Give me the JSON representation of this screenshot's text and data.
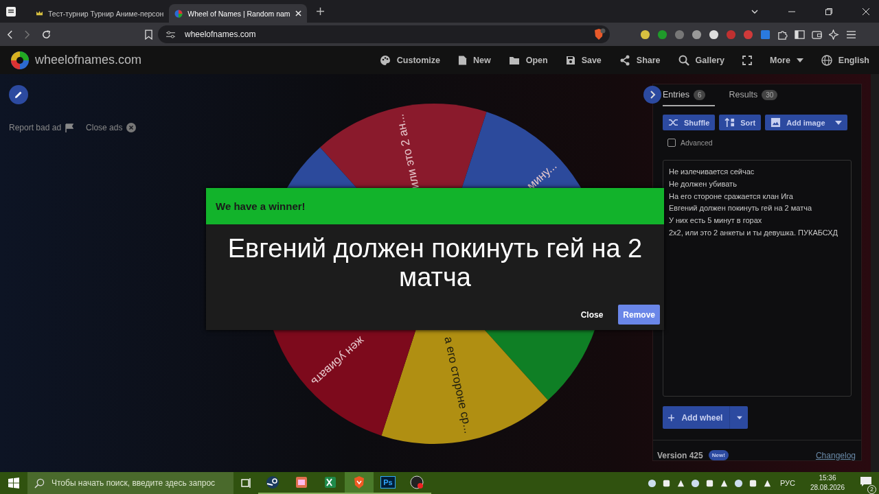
{
  "browser": {
    "tabs": [
      {
        "title": "Тест-турнир Турнир Аниме-персон",
        "selected": false
      },
      {
        "title": "Wheel of Names | Random nam",
        "selected": true
      }
    ],
    "address": "wheelofnames.com"
  },
  "site": {
    "logo": "wheelofnames.com",
    "menu": [
      {
        "kind": "palette",
        "label": "Customize"
      },
      {
        "kind": "file",
        "label": "New"
      },
      {
        "kind": "folder",
        "label": "Open"
      },
      {
        "kind": "disk",
        "label": "Save"
      },
      {
        "kind": "share",
        "label": "Share"
      },
      {
        "kind": "search",
        "label": "Gallery"
      },
      {
        "kind": "fullscreen"
      },
      {
        "kind": "more",
        "label": "More"
      },
      {
        "kind": "globe",
        "label": "English"
      }
    ]
  },
  "ads": {
    "report": "Report bad ad",
    "close": "Close ads"
  },
  "wheel": {
    "slices": [
      {
        "color": "#8a1a2c",
        "label": "или это 2 ан..."
      },
      {
        "color": "#2c4a9c",
        "label": "мину..."
      },
      {
        "color": "#0f7f25"
      },
      {
        "color": "#b08f12",
        "label": "а его стороне ср..."
      },
      {
        "color": "#7d0a1c",
        "label": "жен убивать"
      },
      {
        "color": "#2c4a9c"
      }
    ]
  },
  "modal": {
    "title": "We have a winner!",
    "winner": "Евгений должен покинуть гей на 2 матча",
    "buttons": [
      {
        "kind": "text",
        "label": "Close"
      },
      {
        "kind": "primary",
        "label": "Remove"
      }
    ]
  },
  "panel": {
    "tabs": [
      {
        "label": "Entries",
        "count": "6",
        "selected": true
      },
      {
        "label": "Results",
        "count": "30",
        "selected": false
      }
    ],
    "tools": [
      {
        "kind": "shuffle",
        "label": "Shuffle"
      },
      {
        "kind": "sort",
        "label": "Sort"
      },
      {
        "kind": "image",
        "label": "Add image"
      }
    ],
    "advanced": {
      "label": "Advanced",
      "checked": false
    },
    "entries": [
      "Не излечивается сейчас",
      "Не должен убивать",
      "На его стороне сражается клан Ига",
      "Евгений должен покинуть гей на 2 матча",
      "У них есть 5 минут в горах",
      "2x2, или это 2 анкеты и ты девушка. ПУКАБСХД"
    ],
    "add_wheel": "Add wheel",
    "version": "Version 425",
    "badge": "New!",
    "changelog": "Changelog"
  },
  "taskbar": {
    "search": {
      "placeholder": "Чтобы начать поиск, введите здесь запрос"
    },
    "apps": [
      {
        "kind": "steam",
        "selected": false
      },
      {
        "kind": "office",
        "selected": false
      },
      {
        "kind": "excel",
        "selected": false
      },
      {
        "kind": "brave",
        "selected": true
      },
      {
        "kind": "photoshop",
        "selected": false,
        "label": "Ps"
      },
      {
        "kind": "obs",
        "selected": false
      }
    ],
    "language": "РУС",
    "time": "15:36",
    "date": "28.08.2026",
    "notifications": "2"
  }
}
